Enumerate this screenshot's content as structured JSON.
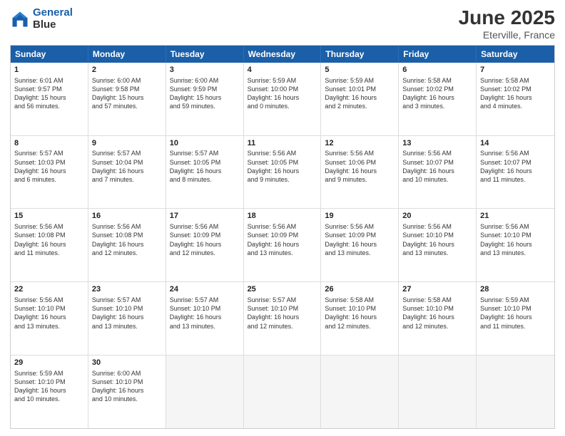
{
  "header": {
    "logo_line1": "General",
    "logo_line2": "Blue",
    "main_title": "June 2025",
    "subtitle": "Eterville, France"
  },
  "days_of_week": [
    "Sunday",
    "Monday",
    "Tuesday",
    "Wednesday",
    "Thursday",
    "Friday",
    "Saturday"
  ],
  "weeks": [
    [
      {
        "day": "1",
        "lines": [
          "Sunrise: 6:01 AM",
          "Sunset: 9:57 PM",
          "Daylight: 15 hours",
          "and 56 minutes."
        ]
      },
      {
        "day": "2",
        "lines": [
          "Sunrise: 6:00 AM",
          "Sunset: 9:58 PM",
          "Daylight: 15 hours",
          "and 57 minutes."
        ]
      },
      {
        "day": "3",
        "lines": [
          "Sunrise: 6:00 AM",
          "Sunset: 9:59 PM",
          "Daylight: 15 hours",
          "and 59 minutes."
        ]
      },
      {
        "day": "4",
        "lines": [
          "Sunrise: 5:59 AM",
          "Sunset: 10:00 PM",
          "Daylight: 16 hours",
          "and 0 minutes."
        ]
      },
      {
        "day": "5",
        "lines": [
          "Sunrise: 5:59 AM",
          "Sunset: 10:01 PM",
          "Daylight: 16 hours",
          "and 2 minutes."
        ]
      },
      {
        "day": "6",
        "lines": [
          "Sunrise: 5:58 AM",
          "Sunset: 10:02 PM",
          "Daylight: 16 hours",
          "and 3 minutes."
        ]
      },
      {
        "day": "7",
        "lines": [
          "Sunrise: 5:58 AM",
          "Sunset: 10:02 PM",
          "Daylight: 16 hours",
          "and 4 minutes."
        ]
      }
    ],
    [
      {
        "day": "8",
        "lines": [
          "Sunrise: 5:57 AM",
          "Sunset: 10:03 PM",
          "Daylight: 16 hours",
          "and 6 minutes."
        ]
      },
      {
        "day": "9",
        "lines": [
          "Sunrise: 5:57 AM",
          "Sunset: 10:04 PM",
          "Daylight: 16 hours",
          "and 7 minutes."
        ]
      },
      {
        "day": "10",
        "lines": [
          "Sunrise: 5:57 AM",
          "Sunset: 10:05 PM",
          "Daylight: 16 hours",
          "and 8 minutes."
        ]
      },
      {
        "day": "11",
        "lines": [
          "Sunrise: 5:56 AM",
          "Sunset: 10:05 PM",
          "Daylight: 16 hours",
          "and 9 minutes."
        ]
      },
      {
        "day": "12",
        "lines": [
          "Sunrise: 5:56 AM",
          "Sunset: 10:06 PM",
          "Daylight: 16 hours",
          "and 9 minutes."
        ]
      },
      {
        "day": "13",
        "lines": [
          "Sunrise: 5:56 AM",
          "Sunset: 10:07 PM",
          "Daylight: 16 hours",
          "and 10 minutes."
        ]
      },
      {
        "day": "14",
        "lines": [
          "Sunrise: 5:56 AM",
          "Sunset: 10:07 PM",
          "Daylight: 16 hours",
          "and 11 minutes."
        ]
      }
    ],
    [
      {
        "day": "15",
        "lines": [
          "Sunrise: 5:56 AM",
          "Sunset: 10:08 PM",
          "Daylight: 16 hours",
          "and 11 minutes."
        ]
      },
      {
        "day": "16",
        "lines": [
          "Sunrise: 5:56 AM",
          "Sunset: 10:08 PM",
          "Daylight: 16 hours",
          "and 12 minutes."
        ]
      },
      {
        "day": "17",
        "lines": [
          "Sunrise: 5:56 AM",
          "Sunset: 10:09 PM",
          "Daylight: 16 hours",
          "and 12 minutes."
        ]
      },
      {
        "day": "18",
        "lines": [
          "Sunrise: 5:56 AM",
          "Sunset: 10:09 PM",
          "Daylight: 16 hours",
          "and 13 minutes."
        ]
      },
      {
        "day": "19",
        "lines": [
          "Sunrise: 5:56 AM",
          "Sunset: 10:09 PM",
          "Daylight: 16 hours",
          "and 13 minutes."
        ]
      },
      {
        "day": "20",
        "lines": [
          "Sunrise: 5:56 AM",
          "Sunset: 10:10 PM",
          "Daylight: 16 hours",
          "and 13 minutes."
        ]
      },
      {
        "day": "21",
        "lines": [
          "Sunrise: 5:56 AM",
          "Sunset: 10:10 PM",
          "Daylight: 16 hours",
          "and 13 minutes."
        ]
      }
    ],
    [
      {
        "day": "22",
        "lines": [
          "Sunrise: 5:56 AM",
          "Sunset: 10:10 PM",
          "Daylight: 16 hours",
          "and 13 minutes."
        ]
      },
      {
        "day": "23",
        "lines": [
          "Sunrise: 5:57 AM",
          "Sunset: 10:10 PM",
          "Daylight: 16 hours",
          "and 13 minutes."
        ]
      },
      {
        "day": "24",
        "lines": [
          "Sunrise: 5:57 AM",
          "Sunset: 10:10 PM",
          "Daylight: 16 hours",
          "and 13 minutes."
        ]
      },
      {
        "day": "25",
        "lines": [
          "Sunrise: 5:57 AM",
          "Sunset: 10:10 PM",
          "Daylight: 16 hours",
          "and 12 minutes."
        ]
      },
      {
        "day": "26",
        "lines": [
          "Sunrise: 5:58 AM",
          "Sunset: 10:10 PM",
          "Daylight: 16 hours",
          "and 12 minutes."
        ]
      },
      {
        "day": "27",
        "lines": [
          "Sunrise: 5:58 AM",
          "Sunset: 10:10 PM",
          "Daylight: 16 hours",
          "and 12 minutes."
        ]
      },
      {
        "day": "28",
        "lines": [
          "Sunrise: 5:59 AM",
          "Sunset: 10:10 PM",
          "Daylight: 16 hours",
          "and 11 minutes."
        ]
      }
    ],
    [
      {
        "day": "29",
        "lines": [
          "Sunrise: 5:59 AM",
          "Sunset: 10:10 PM",
          "Daylight: 16 hours",
          "and 10 minutes."
        ]
      },
      {
        "day": "30",
        "lines": [
          "Sunrise: 6:00 AM",
          "Sunset: 10:10 PM",
          "Daylight: 16 hours",
          "and 10 minutes."
        ]
      },
      {
        "day": "",
        "lines": []
      },
      {
        "day": "",
        "lines": []
      },
      {
        "day": "",
        "lines": []
      },
      {
        "day": "",
        "lines": []
      },
      {
        "day": "",
        "lines": []
      }
    ]
  ]
}
